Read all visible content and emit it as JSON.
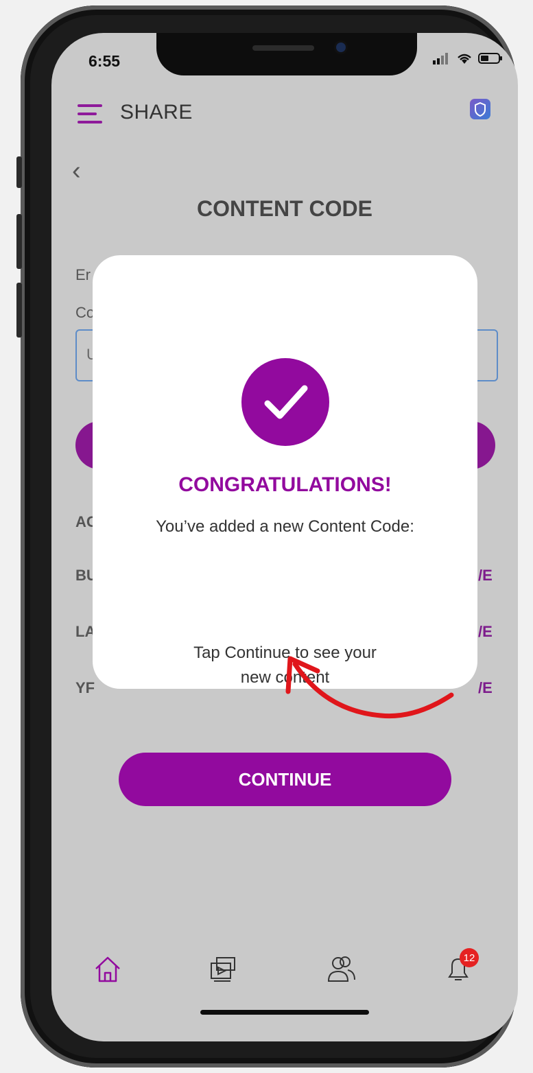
{
  "status_bar": {
    "time": "6:55"
  },
  "header": {
    "title": "SHARE"
  },
  "page": {
    "title": "CONTENT CODE"
  },
  "background": {
    "enter_label_partial": "Er",
    "code_label_partial": "Co",
    "input_value_partial": "U",
    "section_partial": "AC",
    "rows": [
      {
        "name_partial": "BU",
        "action_partial": "/E"
      },
      {
        "name_partial": "LA",
        "action_partial": "/E"
      },
      {
        "name_partial": "YF",
        "action_partial": "/E"
      }
    ]
  },
  "modal": {
    "title": "CONGRATULATIONS!",
    "message": "You’ve added a new Content Code:",
    "instruction_line1": "Tap Continue to see your",
    "instruction_line2": "new content",
    "continue_label": "CONTINUE"
  },
  "tabbar": {
    "items": [
      {
        "icon": "home-icon"
      },
      {
        "icon": "media-icon"
      },
      {
        "icon": "people-icon"
      },
      {
        "icon": "bell-icon",
        "badge": "12"
      }
    ]
  },
  "colors": {
    "accent": "#920a9e",
    "badge": "#e52222",
    "annotation_arrow": "#e0161b"
  }
}
